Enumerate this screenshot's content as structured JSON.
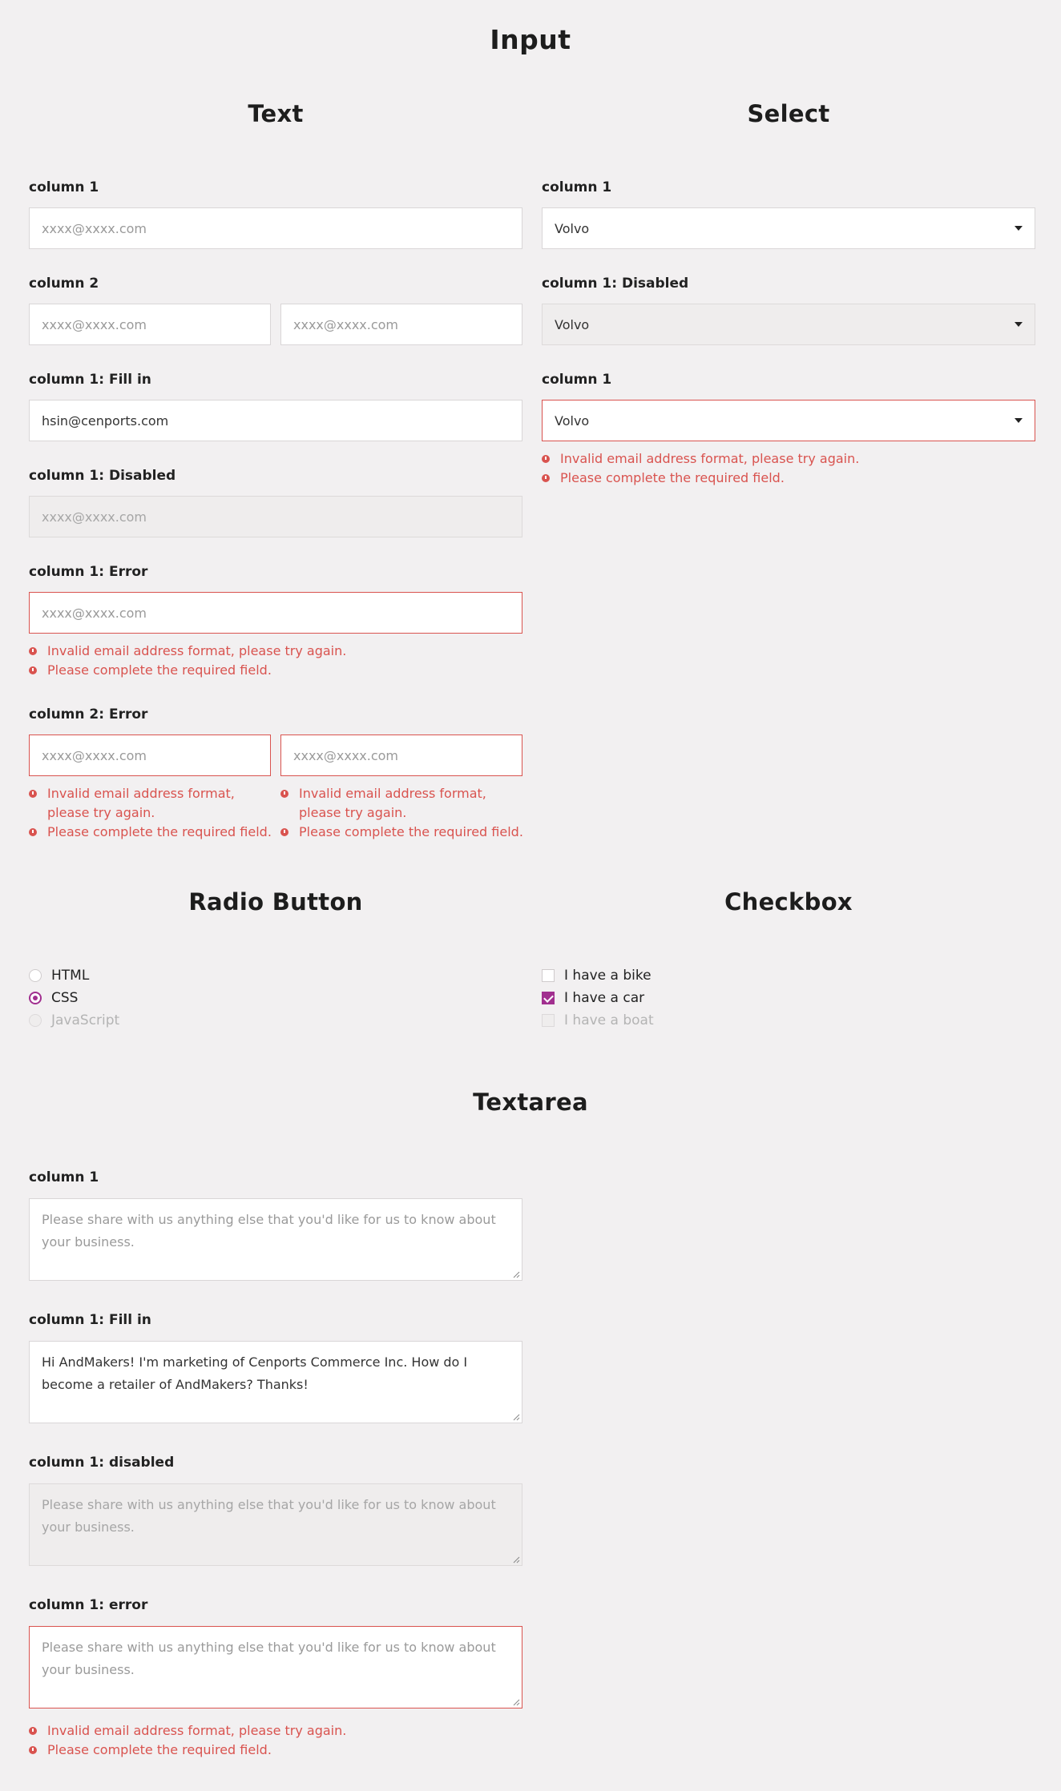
{
  "page_title": "Input",
  "text_section": {
    "title": "Text",
    "col1_label": "column 1",
    "col1_placeholder": "xxxx@xxxx.com",
    "col2_label": "column 2",
    "col2a_placeholder": "xxxx@xxxx.com",
    "col2b_placeholder": "xxxx@xxxx.com",
    "fill_label": "column 1: Fill in",
    "fill_value": "hsin@cenports.com",
    "disabled_label": "column 1: Disabled",
    "disabled_placeholder": "xxxx@xxxx.com",
    "error_label": "column 1: Error",
    "error_placeholder": "xxxx@xxxx.com",
    "error_messages": [
      "Invalid email address format, please try again.",
      "Please complete the required field."
    ],
    "error2_label": "column 2: Error",
    "error2a_placeholder": "xxxx@xxxx.com",
    "error2b_placeholder": "xxxx@xxxx.com",
    "error2_msg_invalid": "Invalid email address format, please try again.",
    "error2_msg_required": "Please complete the required field."
  },
  "select_section": {
    "title": "Select",
    "col1_label": "column 1",
    "col1_value": "Volvo",
    "disabled_label": "column 1: Disabled",
    "disabled_value": "Volvo",
    "error_label": "column 1",
    "error_value": "Volvo",
    "error_messages": [
      "Invalid email address format, please try again.",
      "Please complete the required field."
    ]
  },
  "radio_section": {
    "title": "Radio Button",
    "options": [
      {
        "label": "HTML",
        "state": "unchecked"
      },
      {
        "label": "CSS",
        "state": "checked"
      },
      {
        "label": "JavaScript",
        "state": "disabled"
      }
    ]
  },
  "checkbox_section": {
    "title": "Checkbox",
    "options": [
      {
        "label": "I have a bike",
        "state": "unchecked"
      },
      {
        "label": "I have a car",
        "state": "checked"
      },
      {
        "label": "I have a boat",
        "state": "disabled"
      }
    ]
  },
  "textarea_section": {
    "title": "Textarea",
    "col1_label": "column 1",
    "col1_placeholder": "Please share with us anything else that you'd like for us to know about your business.",
    "fill_label": "column 1: Fill in",
    "fill_value": "Hi AndMakers! I'm marketing of Cenports Commerce Inc. How do I become a retailer of AndMakers? Thanks!",
    "disabled_label": "column 1: disabled",
    "disabled_placeholder": "Please share with us anything else that you'd like for us to know about your business.",
    "error_label": "column 1: error",
    "error_placeholder": "Please share with us anything else that you'd like for us to know about your business.",
    "error_messages": [
      "Invalid email address format, please try again.",
      "Please complete the required field."
    ]
  },
  "colors": {
    "accent": "#a12f8f",
    "error": "#d9534f",
    "background": "#f2f0f1"
  }
}
